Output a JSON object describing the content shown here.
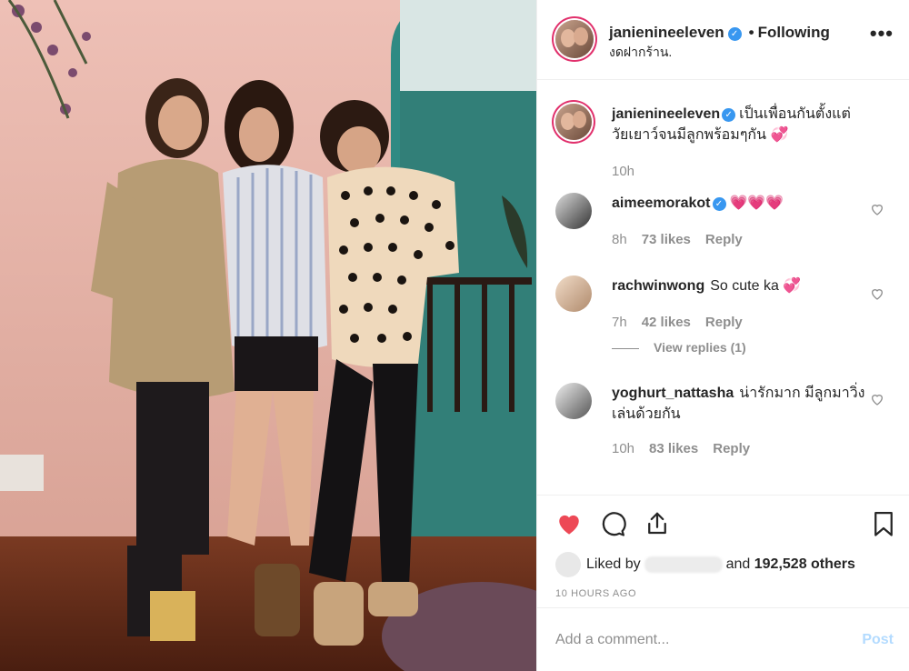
{
  "post": {
    "author": "janienineeleven",
    "follow_status": "Following",
    "location": "งดฝากร้าน."
  },
  "caption": {
    "username": "janienineeleven",
    "text": "เป็นเพื่อนกันตั้งแต่วัยเยาว์จนมีลูกพร้อมๆกัน 💞",
    "time": "10h"
  },
  "comments": [
    {
      "username": "aimeemorakot",
      "verified": true,
      "text": "💗💗💗",
      "time": "8h",
      "likes": "73 likes",
      "reply": "Reply"
    },
    {
      "username": "rachwinwong",
      "verified": false,
      "text": "So cute ka 💞",
      "time": "7h",
      "likes": "42 likes",
      "reply": "Reply",
      "view_replies": "View replies (1)"
    },
    {
      "username": "yoghurt_nattasha",
      "verified": false,
      "text": "น่ารักมาก มีลูกมาวิ่งเล่นด้วยกัน",
      "time": "10h",
      "likes": "83 likes",
      "reply": "Reply"
    }
  ],
  "likes": {
    "prefix": "Liked by",
    "suffix": "and",
    "count": "192,528 others"
  },
  "timestamp": "10 HOURS AGO",
  "add_comment": {
    "placeholder": "Add a comment...",
    "post_label": "Post"
  },
  "icons": {
    "like": "heart-filled-icon",
    "comment": "comment-bubble-icon",
    "share": "share-icon",
    "save": "bookmark-icon",
    "more": "more-options-icon",
    "verified": "verified-badge-icon"
  },
  "colors": {
    "like_red": "#ed4956",
    "verified_blue": "#3897f0",
    "post_disabled": "#b3dbff",
    "muted_text": "#8e8e8e"
  }
}
